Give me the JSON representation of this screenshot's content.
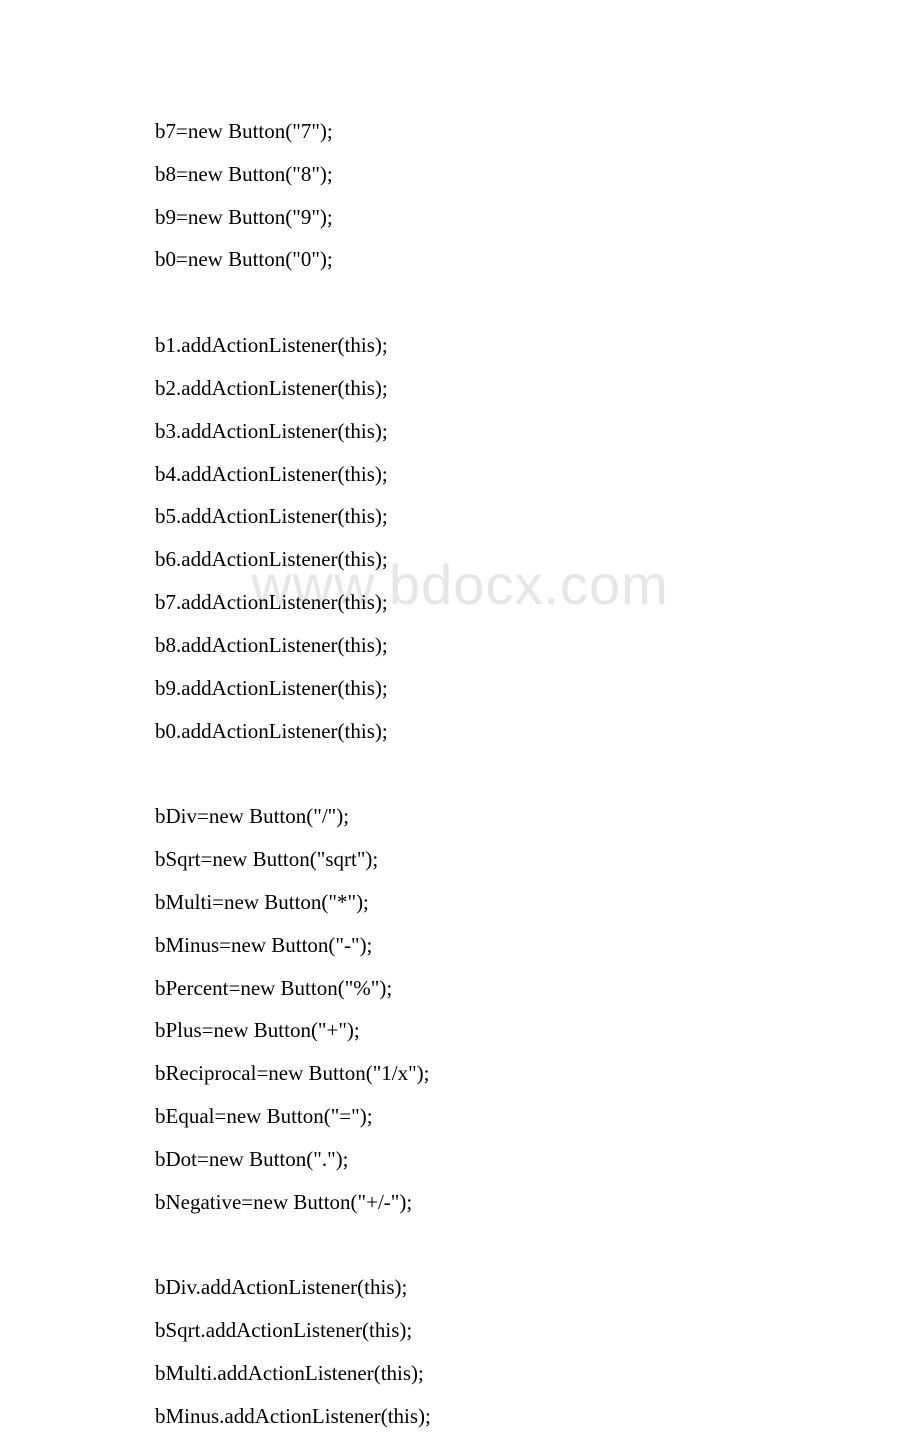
{
  "watermark": "www.bdocx.com",
  "lines": [
    "b7=new Button(\"7\");",
    "b8=new Button(\"8\");",
    "b9=new Button(\"9\");",
    "b0=new Button(\"0\");",
    "",
    "b1.addActionListener(this);",
    "b2.addActionListener(this);",
    "b3.addActionListener(this);",
    "b4.addActionListener(this);",
    "b5.addActionListener(this);",
    "b6.addActionListener(this);",
    "b7.addActionListener(this);",
    "b8.addActionListener(this);",
    "b9.addActionListener(this);",
    "b0.addActionListener(this);",
    "",
    "bDiv=new Button(\"/\");",
    "bSqrt=new Button(\"sqrt\");",
    "bMulti=new Button(\"*\");",
    "bMinus=new Button(\"-\");",
    "bPercent=new Button(\"%\");",
    "bPlus=new Button(\"+\");",
    "bReciprocal=new Button(\"1/x\");",
    "bEqual=new Button(\"=\");",
    "bDot=new Button(\".\");",
    "bNegative=new Button(\"+/-\");",
    "",
    "bDiv.addActionListener(this);",
    "bSqrt.addActionListener(this);",
    "bMulti.addActionListener(this);",
    "bMinus.addActionListener(this);"
  ]
}
